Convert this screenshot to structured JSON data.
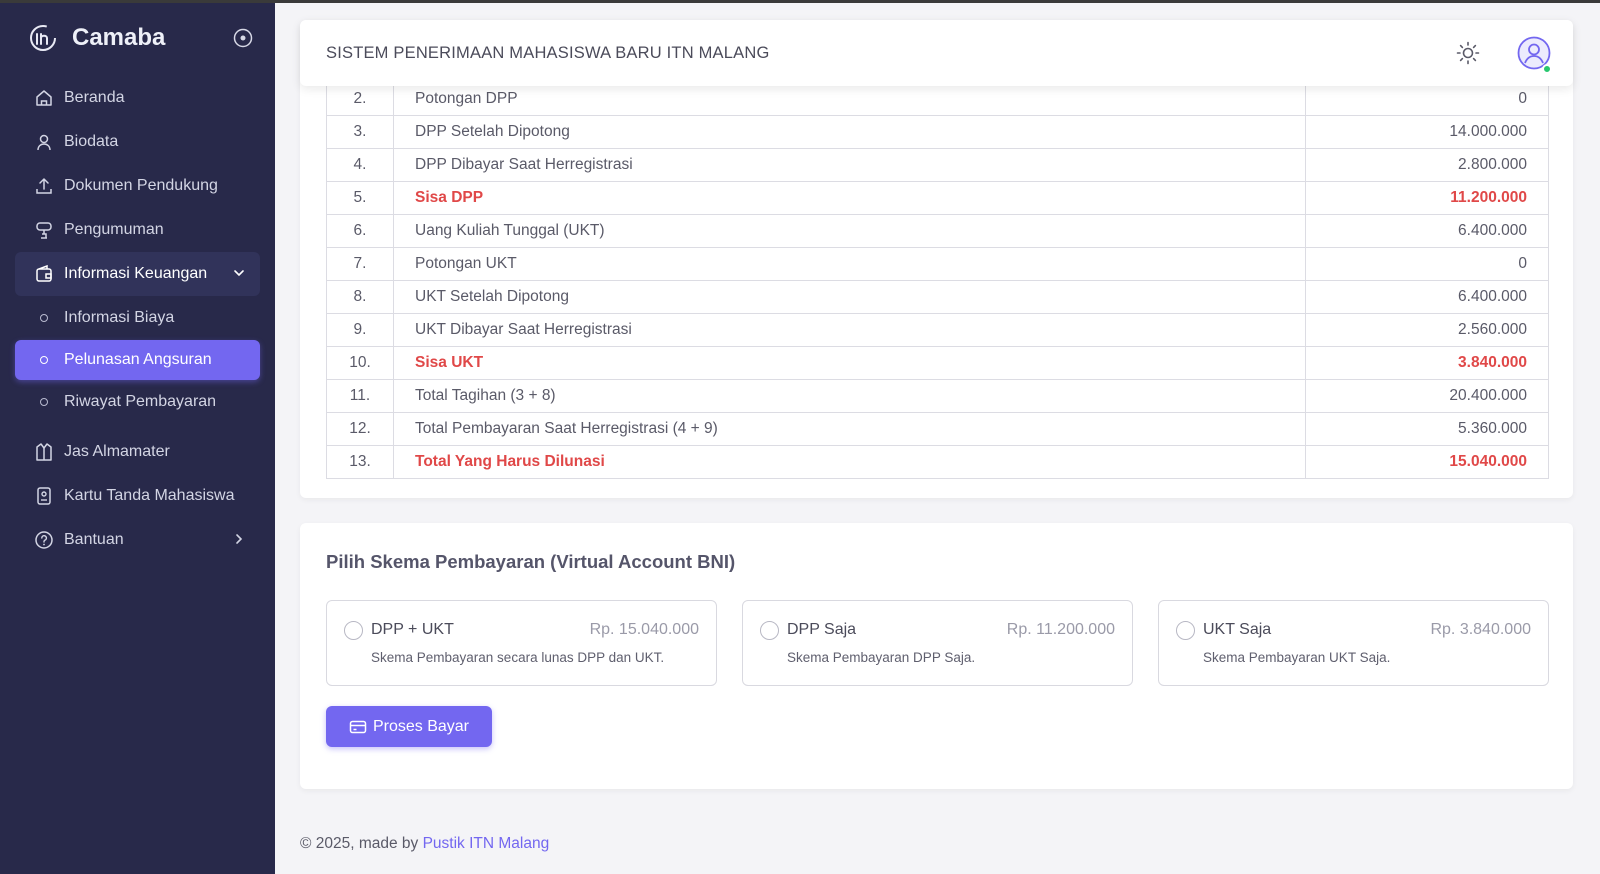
{
  "sidebar": {
    "brand": "Camaba",
    "items": [
      {
        "label": "Beranda",
        "icon": "home-icon"
      },
      {
        "label": "Biodata",
        "icon": "user-icon"
      },
      {
        "label": "Dokumen Pendukung",
        "icon": "upload-icon"
      },
      {
        "label": "Pengumuman",
        "icon": "presentation-icon"
      },
      {
        "label": "Informasi Keuangan",
        "icon": "wallet-icon"
      }
    ],
    "submenu": [
      {
        "label": "Informasi Biaya"
      },
      {
        "label": "Pelunasan Angsuran"
      },
      {
        "label": "Riwayat Pembayaran"
      }
    ],
    "items_bottom": [
      {
        "label": "Jas Almamater",
        "icon": "jacket-icon"
      },
      {
        "label": "Kartu Tanda Mahasiswa",
        "icon": "id-card-icon"
      },
      {
        "label": "Bantuan",
        "icon": "help-icon"
      }
    ]
  },
  "header": {
    "title": "SISTEM PENERIMAAN MAHASISWA BARU ITN MALANG"
  },
  "fees": {
    "rows": [
      {
        "no": "2.",
        "desc": "Potongan DPP",
        "value": "0"
      },
      {
        "no": "3.",
        "desc": "DPP Setelah Dipotong",
        "value": "14.000.000"
      },
      {
        "no": "4.",
        "desc": "DPP Dibayar Saat Herregistrasi",
        "value": "2.800.000"
      },
      {
        "no": "5.",
        "desc": "Sisa DPP",
        "value": "11.200.000",
        "highlight": true
      },
      {
        "no": "6.",
        "desc": "Uang Kuliah Tunggal (UKT)",
        "value": "6.400.000"
      },
      {
        "no": "7.",
        "desc": "Potongan UKT",
        "value": "0"
      },
      {
        "no": "8.",
        "desc": "UKT Setelah Dipotong",
        "value": "6.400.000"
      },
      {
        "no": "9.",
        "desc": "UKT Dibayar Saat Herregistrasi",
        "value": "2.560.000"
      },
      {
        "no": "10.",
        "desc": "Sisa UKT",
        "value": "3.840.000",
        "highlight": true
      },
      {
        "no": "11.",
        "desc": "Total Tagihan (3 + 8)",
        "value": "20.400.000"
      },
      {
        "no": "12.",
        "desc": "Total Pembayaran Saat Herregistrasi (4 + 9)",
        "value": "5.360.000"
      },
      {
        "no": "13.",
        "desc": "Total Yang Harus Dilunasi",
        "value": "15.040.000",
        "highlight": true
      }
    ]
  },
  "payment": {
    "title": "Pilih Skema Pembayaran (Virtual Account BNI)",
    "options": [
      {
        "name": "DPP + UKT",
        "price": "Rp. 15.040.000",
        "desc": "Skema Pembayaran secara lunas DPP dan UKT."
      },
      {
        "name": "DPP Saja",
        "price": "Rp. 11.200.000",
        "desc": "Skema Pembayaran DPP Saja."
      },
      {
        "name": "UKT Saja",
        "price": "Rp. 3.840.000",
        "desc": "Skema Pembayaran UKT Saja."
      }
    ],
    "button": "Proses Bayar"
  },
  "footer": {
    "text": "© 2025, made by ",
    "link": "Pustik ITN Malang"
  },
  "colors": {
    "sidebar_bg": "#28294a",
    "accent": "#7367f0",
    "danger": "#e04848",
    "status_online": "#28c76f"
  }
}
